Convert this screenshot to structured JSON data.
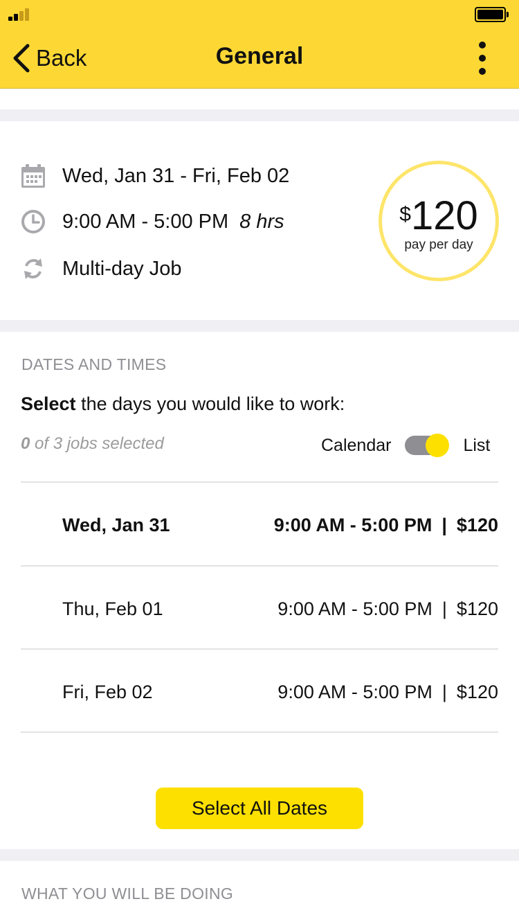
{
  "nav": {
    "back_label": "Back",
    "title": "General"
  },
  "summary": {
    "dates": "Wed, Jan 31 - Fri, Feb 02",
    "time": "9:00 AM - 5:00 PM",
    "hours": "8 hrs",
    "job_type": "Multi-day Job",
    "pay": {
      "currency": "$",
      "amount": "120",
      "label": "pay per day"
    }
  },
  "dates_section": {
    "heading": "DATES AND TIMES",
    "instruction_bold": "Select",
    "instruction_rest": " the days you would like to work:",
    "count_bold": "0",
    "count_rest": " of 3 jobs selected",
    "view_left": "Calendar",
    "view_right": "List",
    "rows": [
      {
        "date": "Wed, Jan 31",
        "time": "9:00 AM - 5:00 PM",
        "sep": "|",
        "price": "$120"
      },
      {
        "date": "Thu, Feb 01",
        "time": "9:00 AM - 5:00 PM",
        "sep": "|",
        "price": "$120"
      },
      {
        "date": "Fri, Feb 02",
        "time": "9:00 AM - 5:00 PM",
        "sep": "|",
        "price": "$120"
      }
    ],
    "select_all_label": "Select All Dates"
  },
  "doing_section": {
    "heading": "WHAT YOU WILL BE DOING"
  },
  "colors": {
    "accent": "#fdd835",
    "button": "#fde000",
    "pay_ring": "#fde56a",
    "muted": "#8e8e93"
  }
}
